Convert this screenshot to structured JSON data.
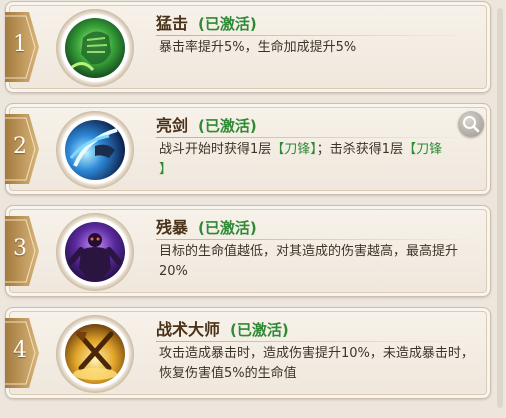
{
  "skills": [
    {
      "number": "1",
      "name": "猛击",
      "status": "(已激活)",
      "desc": "暴击率提升5%，生命加成提升5%",
      "icon": "green-fist-icon"
    },
    {
      "number": "2",
      "name": "亮剑",
      "status": "(已激活)",
      "desc_parts": [
        "战斗开始时获得1层",
        "【刀锋】",
        "；击杀获得1层",
        "【刀锋",
        "】"
      ],
      "icon": "blue-blade-icon"
    },
    {
      "number": "3",
      "name": "残暴",
      "status": "(已激活)",
      "desc": "目标的生命值越低，对其造成的伤害越高，最高提升20%",
      "icon": "purple-brute-icon"
    },
    {
      "number": "4",
      "name": "战术大师",
      "status": "(已激活)",
      "desc": "攻击造成暴击时，造成伤害提升10%，未造成暴击时，恢复伤害值5%的生命值",
      "icon": "golden-weapons-icon"
    }
  ],
  "colors": {
    "tab": "#c9a36a",
    "status": "#2f8a36",
    "name": "#4a3219"
  },
  "zoom_icon": "magnifier-icon"
}
